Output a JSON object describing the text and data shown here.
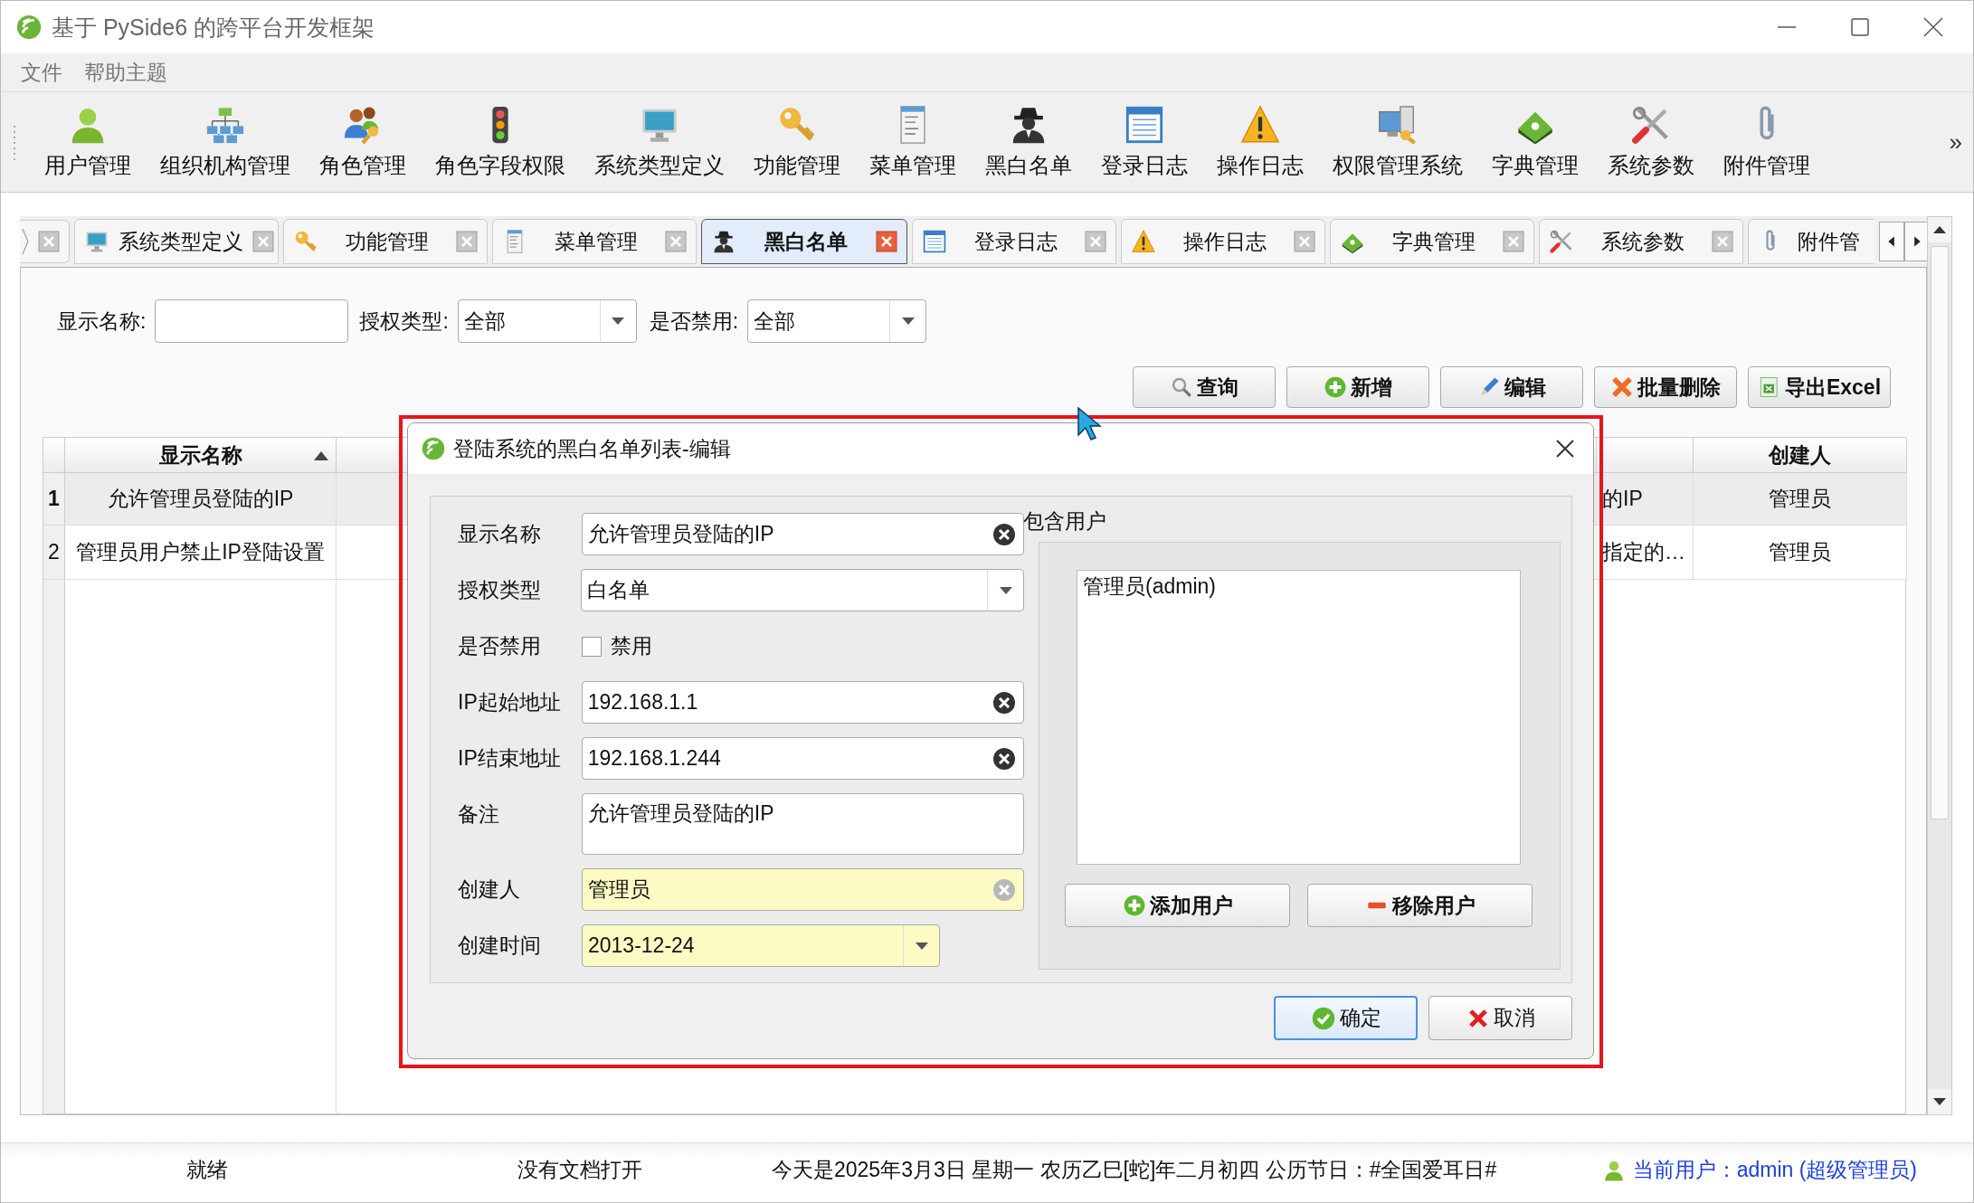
{
  "window": {
    "title": "基于 PySide6 的跨平台开发框架"
  },
  "menu": [
    "文件",
    "帮助主题"
  ],
  "toolbar": {
    "items": [
      "用户管理",
      "组织机构管理",
      "角色管理",
      "角色字段权限",
      "系统类型定义",
      "功能管理",
      "菜单管理",
      "黑白名单",
      "登录日志",
      "操作日志",
      "权限管理系统",
      "字典管理",
      "系统参数",
      "附件管理"
    ],
    "overflow": "»"
  },
  "tabs": [
    {
      "label": "系统类型定义",
      "selected": false
    },
    {
      "label": "功能管理",
      "selected": false
    },
    {
      "label": "菜单管理",
      "selected": false
    },
    {
      "label": "黑白名单",
      "selected": true
    },
    {
      "label": "登录日志",
      "selected": false
    },
    {
      "label": "操作日志",
      "selected": false
    },
    {
      "label": "字典管理",
      "selected": false
    },
    {
      "label": "系统参数",
      "selected": false
    },
    {
      "label": "附件管",
      "selected": false
    }
  ],
  "filters": [
    {
      "label": "显示名称:",
      "kind": "text"
    },
    {
      "label": "授权类型:",
      "kind": "combo",
      "value": "全部"
    },
    {
      "label": "是否禁用:",
      "kind": "combo",
      "value": "全部"
    }
  ],
  "actions": [
    "查询",
    "新增",
    "编辑",
    "批量删除",
    "导出Excel"
  ],
  "table": {
    "columns": [
      {
        "label": "显示名称",
        "sorted": true
      },
      {
        "label": "创建人",
        "sorted": false
      }
    ],
    "rows": [
      {
        "number": "1",
        "name": "允许管理员登陆的IP",
        "column_3": "的IP",
        "creator": "管理员",
        "selected": true
      },
      {
        "number": "2",
        "name": "管理员用户禁止IP登陆设置",
        "column_3": "指定的…",
        "creator": "管理员",
        "selected": false
      }
    ]
  },
  "dialog": {
    "title": "登陆系统的黑白名单列表-编辑",
    "fields": [
      {
        "label": "显示名称",
        "kind": "text",
        "value": "允许管理员登陆的IP",
        "readonly": false
      },
      {
        "label": "授权类型",
        "kind": "combo",
        "value": "白名单",
        "readonly": false
      },
      {
        "label": "是否禁用",
        "kind": "checkbox",
        "text": "禁用",
        "checked": false
      },
      {
        "label": "IP起始地址",
        "kind": "text",
        "value": "192.168.1.1",
        "readonly": false
      },
      {
        "label": "IP结束地址",
        "kind": "text",
        "value": "192.168.1.244",
        "readonly": false
      },
      {
        "label": "备注",
        "kind": "multiline",
        "value": "允许管理员登陆的IP",
        "readonly": false
      },
      {
        "label": "创建人",
        "kind": "text",
        "value": "管理员",
        "readonly": true
      },
      {
        "label": "创建时间",
        "kind": "date",
        "value": "2013-12-24",
        "readonly": true
      }
    ],
    "users_group": {
      "title": "包含用户",
      "users": [
        {
          "label": "管理员(admin)",
          "selected": false
        }
      ],
      "buttons": [
        "添加用户",
        "移除用户"
      ]
    },
    "buttons": [
      {
        "label": "确定",
        "default": true
      },
      {
        "label": "取消",
        "default": false
      }
    ]
  },
  "status_bar": {
    "status": "就绪",
    "document": "没有文档打开",
    "date": "今天是2025年3月3日 星期一 农历乙巳[蛇]年二月初四 公历节日：#全国爱耳日#",
    "user": "当前用户：admin (超级管理员)"
  }
}
